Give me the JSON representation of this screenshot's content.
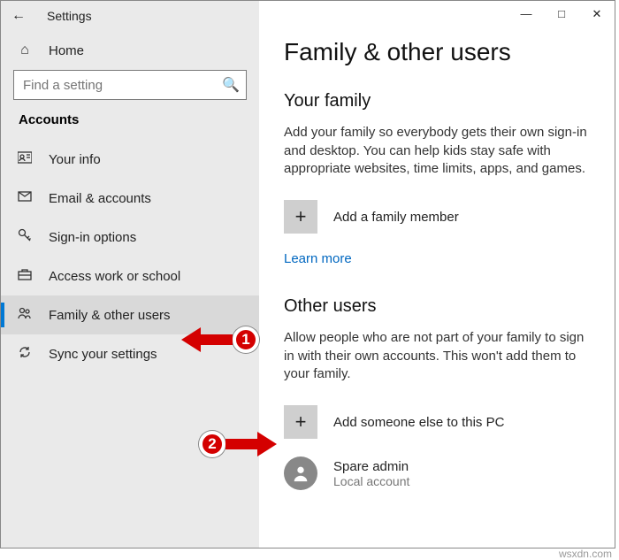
{
  "titlebar": {
    "title": "Settings"
  },
  "home": {
    "label": "Home"
  },
  "search": {
    "placeholder": "Find a setting"
  },
  "sidebar": {
    "section": "Accounts",
    "items": [
      {
        "label": "Your info"
      },
      {
        "label": "Email & accounts"
      },
      {
        "label": "Sign-in options"
      },
      {
        "label": "Access work or school"
      },
      {
        "label": "Family & other users"
      },
      {
        "label": "Sync your settings"
      }
    ]
  },
  "main": {
    "heading": "Family & other users",
    "family": {
      "title": "Your family",
      "desc": "Add your family so everybody gets their own sign-in and desktop. You can help kids stay safe with appropriate websites, time limits, apps, and games.",
      "add": "Add a family member",
      "learn": "Learn more"
    },
    "other": {
      "title": "Other users",
      "desc": "Allow people who are not part of your family to sign in with their own accounts. This won't add them to your family.",
      "add": "Add someone else to this PC",
      "user": {
        "name": "Spare admin",
        "role": "Local account"
      }
    }
  },
  "callouts": {
    "c1": "1",
    "c2": "2"
  },
  "watermark": "wsxdn.com"
}
